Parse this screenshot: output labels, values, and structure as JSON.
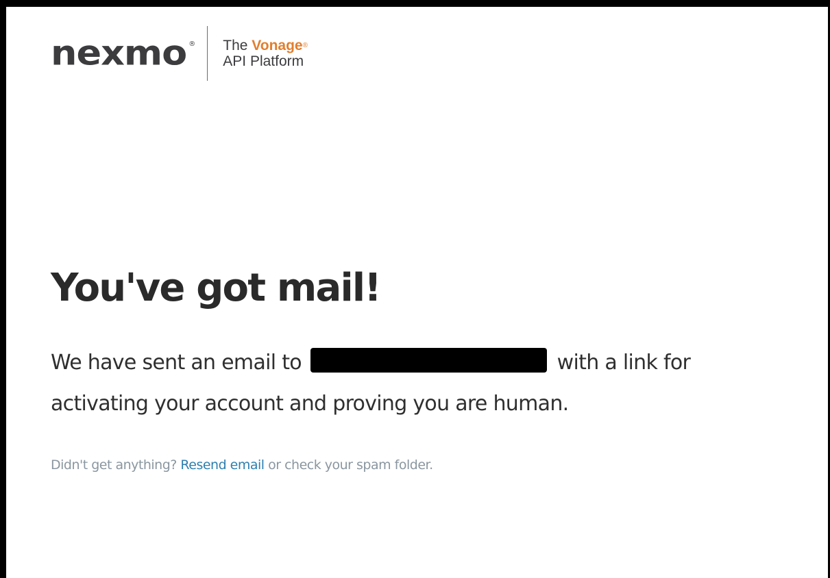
{
  "header": {
    "logo_text": "nexmo",
    "logo_registered": "®",
    "tagline_prefix": "The",
    "tagline_brand": "Vonage",
    "tagline_brand_registered": "®",
    "tagline_suffix": "API Platform"
  },
  "main": {
    "headline": "You've got mail!",
    "message_before": "We have sent an email to",
    "message_after": "with a link for activating your account and proving you are human.",
    "help_before": "Didn't get anything?",
    "resend_link": "Resend email",
    "help_after": "or check your spam folder."
  },
  "colors": {
    "brand_orange": "#e27e2d",
    "link_blue": "#2c7fb0",
    "muted_text": "#8a96a0",
    "logo_accent": "#1e7fc0"
  }
}
